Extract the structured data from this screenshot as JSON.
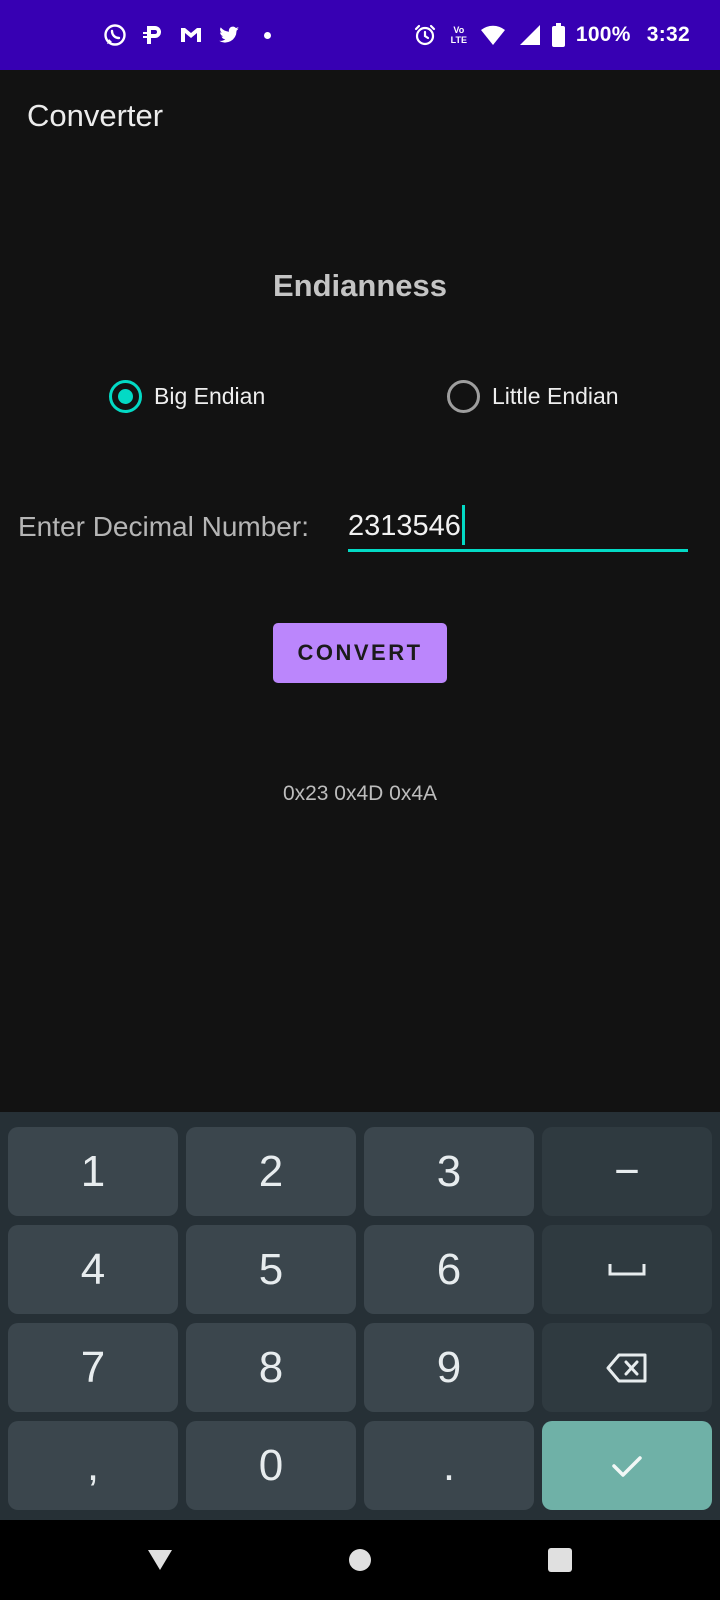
{
  "status_bar": {
    "notification_icons": [
      "whatsapp-icon",
      "paytm-icon",
      "gmail-icon",
      "twitter-icon",
      "more-dot-icon"
    ],
    "volte_label": "Vo LTE",
    "battery_percent": "100%",
    "time": "3:32",
    "background_color": "#3700b3"
  },
  "app_bar": {
    "title": "Converter"
  },
  "main": {
    "heading": "Endianness",
    "radio_options": [
      {
        "label": "Big Endian",
        "checked": true
      },
      {
        "label": "Little Endian",
        "checked": false
      }
    ],
    "input_label": "Enter Decimal Number:",
    "input_value": "2313546",
    "convert_button": "CONVERT",
    "result": "0x23 0x4D 0x4A",
    "accent_color": "#03dac5",
    "button_color": "#bb86fc"
  },
  "keyboard": {
    "rows": [
      [
        "1",
        "2",
        "3",
        "−"
      ],
      [
        "4",
        "5",
        "6",
        "space-icon"
      ],
      [
        "7",
        "8",
        "9",
        "backspace-icon"
      ],
      [
        ",",
        "0",
        ".",
        "check-icon"
      ]
    ],
    "keys": {
      "k1": "1",
      "k2": "2",
      "k3": "3",
      "minus": "−",
      "k4": "4",
      "k5": "5",
      "k6": "6",
      "k7": "7",
      "k8": "8",
      "k9": "9",
      "comma": ",",
      "k0": "0",
      "period": "."
    },
    "done_color": "#6fb1a7"
  },
  "nav_bar": {
    "buttons": [
      "back-icon",
      "home-icon",
      "recents-icon"
    ]
  }
}
